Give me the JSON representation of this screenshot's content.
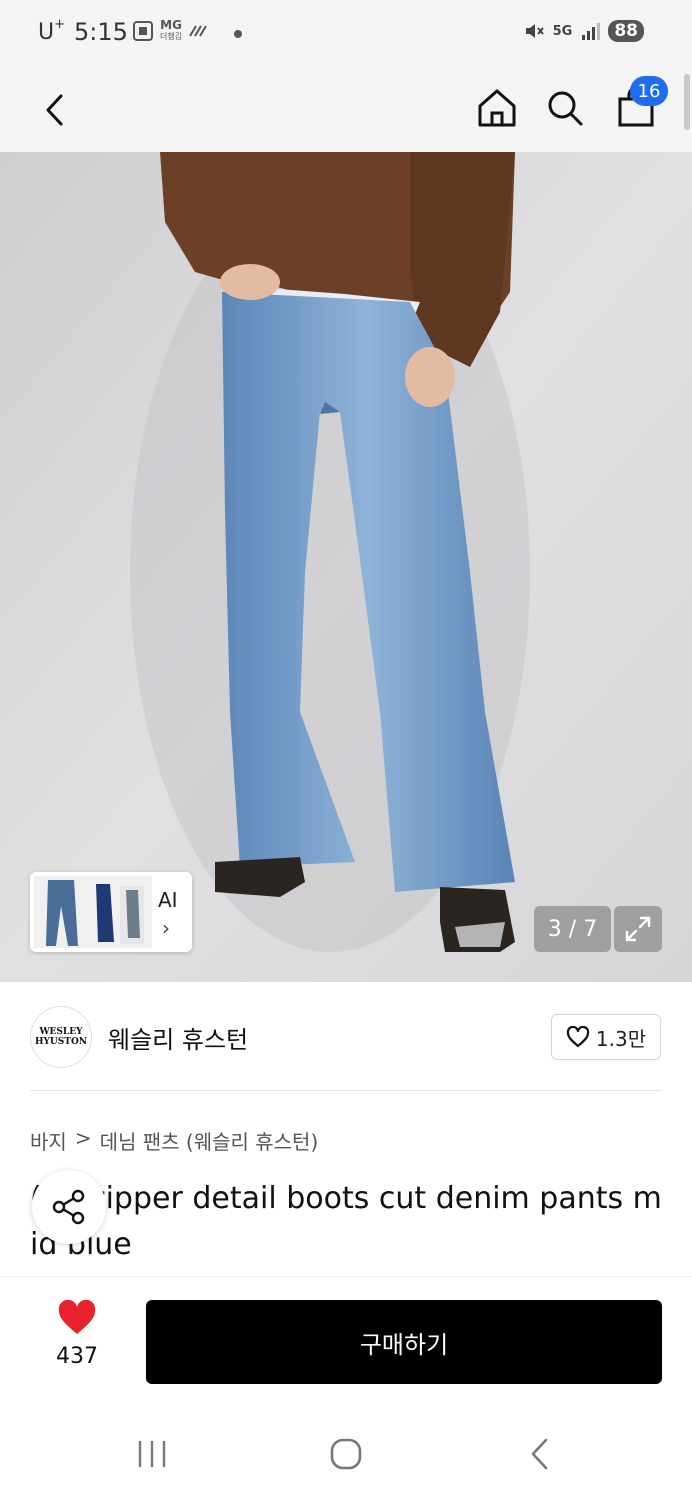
{
  "status_bar": {
    "carrier": "U",
    "carrier_sup": "+",
    "time": "5:15",
    "mg_top": "MG",
    "mg_bottom": "더챙김",
    "network": "5G",
    "battery": "88"
  },
  "nav": {
    "cart_count": "16"
  },
  "gallery": {
    "ai_label": "AI",
    "ai_chevron": "›",
    "page_indicator": "3 / 7"
  },
  "brand": {
    "logo_line1": "WESLEY",
    "logo_line2": "HYUSTON",
    "name": "웨슬리 휴스턴",
    "like_count": "1.3만"
  },
  "breadcrumb": {
    "category": "바지",
    "separator": ">",
    "subcategory": "데님 팬츠 (웨슬리 휴스턴)"
  },
  "product": {
    "title_visible": "( )k zipper detail boots cut denim pants mid blue"
  },
  "bottom_bar": {
    "likes": "437",
    "buy_label": "구매하기"
  },
  "colors": {
    "accent_blue": "#1e6cf0",
    "heart_red": "#e8232e",
    "buy_button": "#000000"
  }
}
